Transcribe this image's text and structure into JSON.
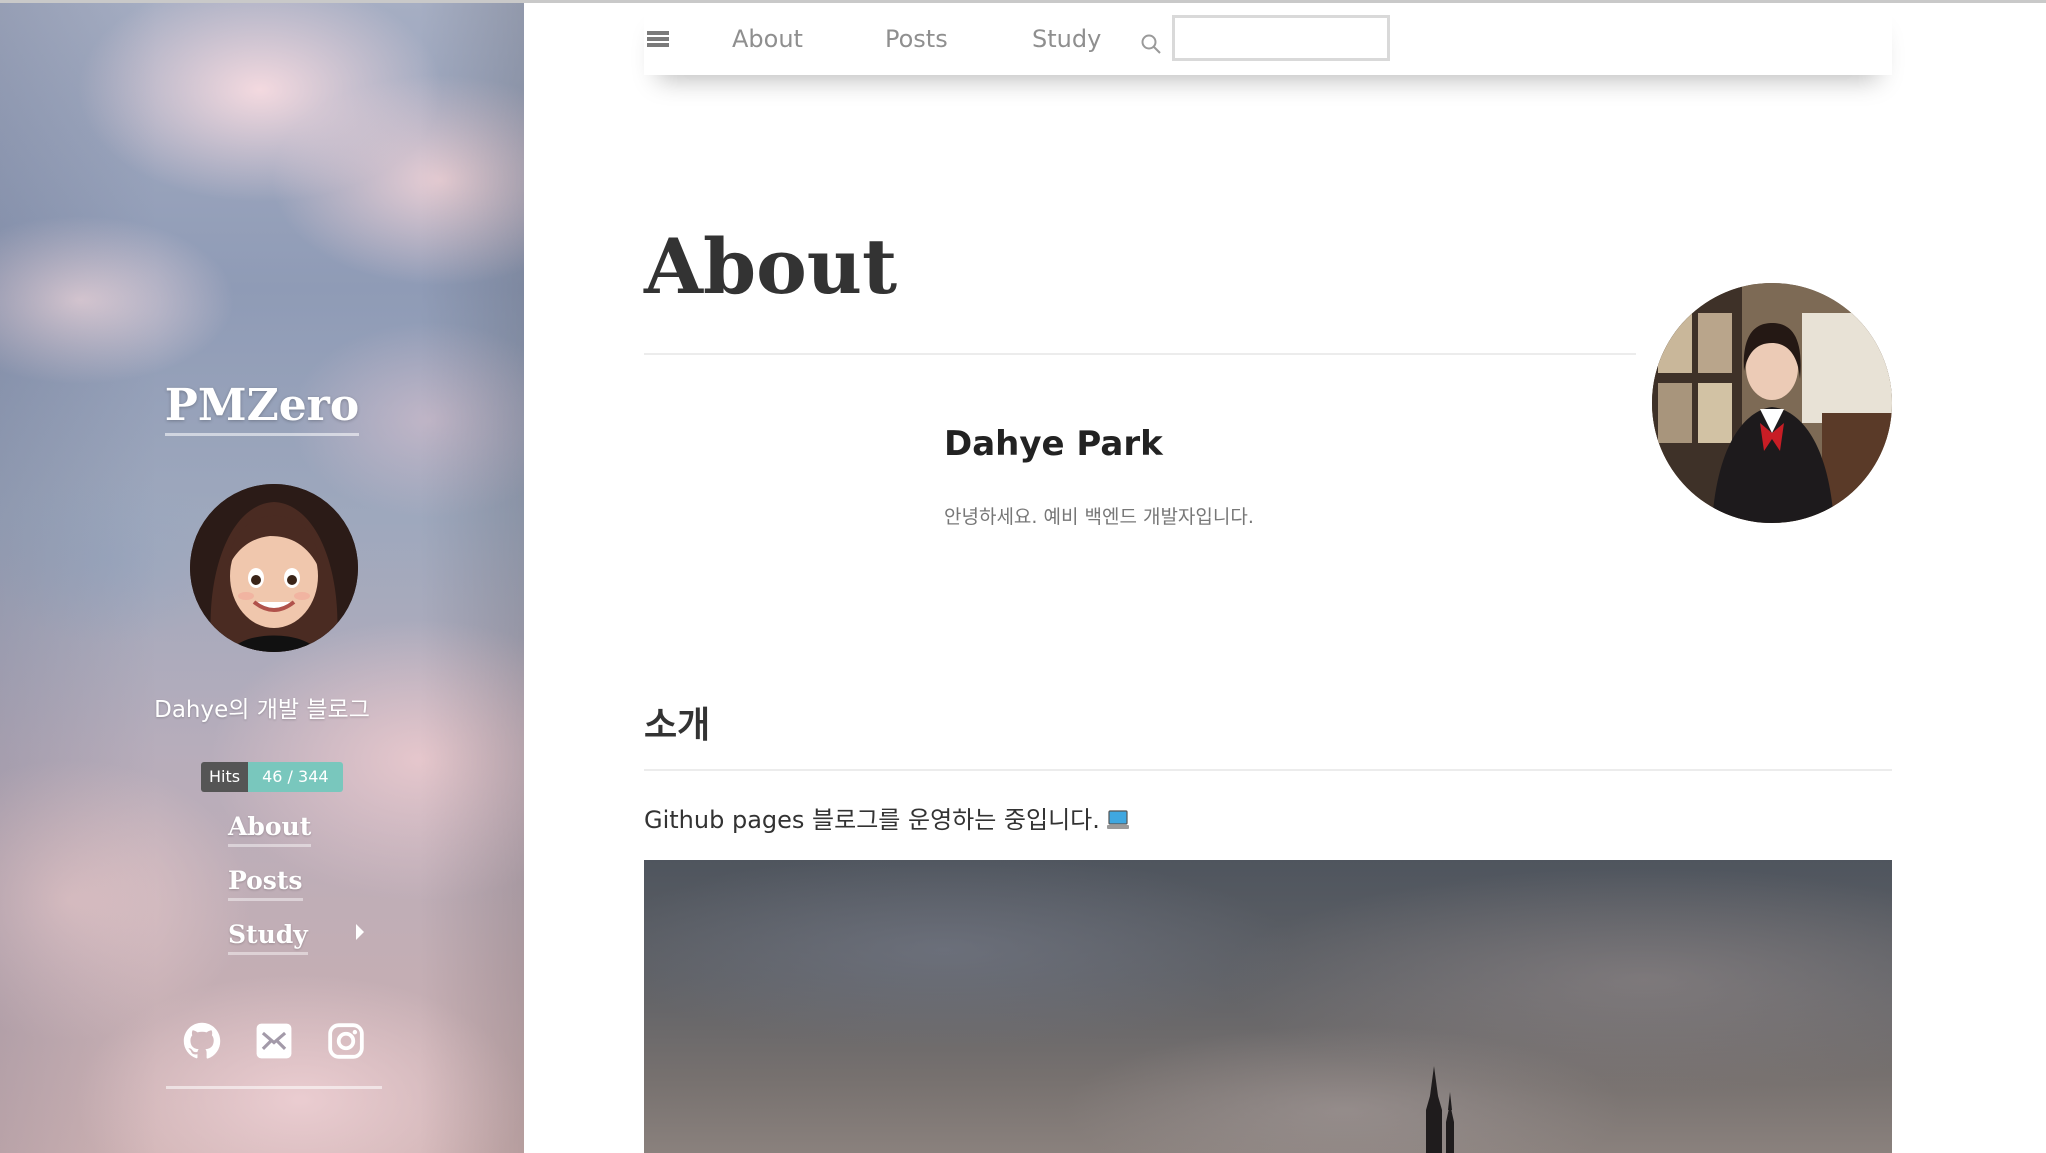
{
  "sidebar": {
    "brand": "PMZero",
    "tagline": "Dahye의 개발 블로그",
    "hits": {
      "label": "Hits",
      "value": "46 / 344"
    },
    "nav": [
      {
        "label": "About"
      },
      {
        "label": "Posts"
      },
      {
        "label": "Study",
        "has_submenu": true
      }
    ],
    "social": [
      "github-icon",
      "mail-icon",
      "instagram-icon"
    ]
  },
  "topnav": {
    "links": [
      {
        "label": "About"
      },
      {
        "label": "Posts"
      },
      {
        "label": "Study"
      }
    ],
    "search": {
      "value": "",
      "placeholder": ""
    }
  },
  "main": {
    "title": "About",
    "profile": {
      "name": "Dahye Park",
      "description": "안녕하세요. 예비 백엔드 개발자입니다."
    },
    "section": {
      "heading": "소개",
      "text": "Github pages 블로그를 운영하는 중입니다."
    }
  },
  "colors": {
    "hits_value_bg": "#79c7bd",
    "hits_label_bg": "#555555",
    "text_dark": "#333333",
    "nav_text": "#8f8f8f"
  }
}
